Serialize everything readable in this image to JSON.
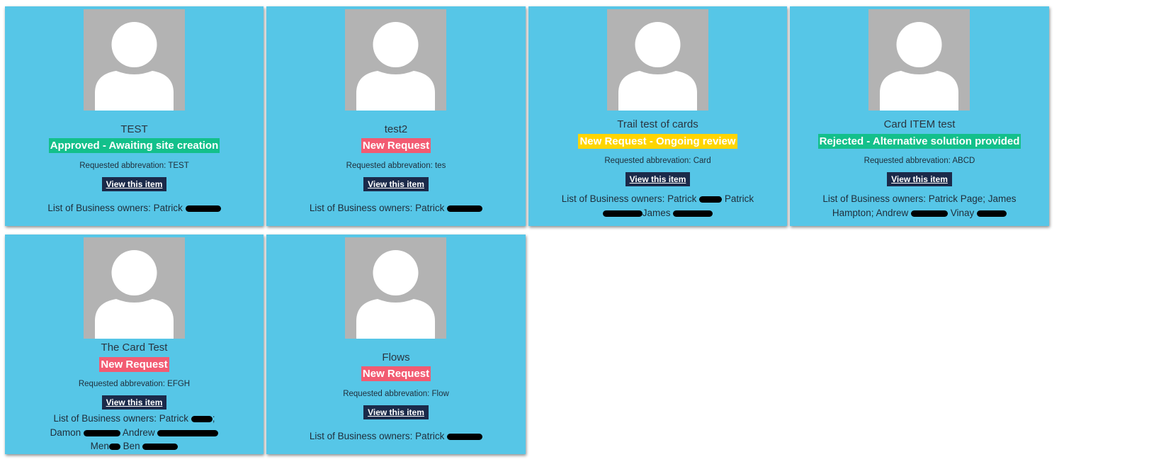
{
  "button_label": "View this item",
  "abbr_prefix": "Requested abbrevation: ",
  "owners_prefix": "List of Business owners: ",
  "colors": {
    "card_bg": "#56c6e7",
    "status_green": "#13c08b",
    "status_red": "#f25b72",
    "status_yellow": "#ffd500",
    "button_bg": "#1b2a4a",
    "avatar_bg": "#b3b3b3"
  },
  "icons": {
    "avatar": "person-placeholder-icon"
  },
  "cards": [
    {
      "title": "TEST",
      "status": "Approved - Awaiting site creation",
      "status_color": "green",
      "abbreviation": "TEST",
      "owners_lines": [
        "Patrick"
      ]
    },
    {
      "title": "test2",
      "status": "New Request",
      "status_color": "red",
      "abbreviation": "tes",
      "owners_lines": [
        "Patrick"
      ]
    },
    {
      "title": "Trail test of cards",
      "status": "New Request - Ongoing review",
      "status_color": "yellow",
      "abbreviation": "Card",
      "owners_lines": [
        "Patrick",
        "Patrick",
        "James"
      ]
    },
    {
      "title": "Card ITEM test",
      "status": "Rejected - Alternative solution provided",
      "status_color": "green",
      "abbreviation": "ABCD",
      "owners_lines": [
        "Patrick Page; James",
        "Hampton; Andrew",
        "Vinay"
      ]
    },
    {
      "title": "The Card Test",
      "status": "New Request",
      "status_color": "red",
      "abbreviation": "EFGH",
      "owners_lines": [
        "Patrick",
        "Damon",
        "Andrew",
        "Men",
        "Ben"
      ]
    },
    {
      "title": "Flows",
      "status": "New Request",
      "status_color": "red",
      "abbreviation": "Flow",
      "owners_lines": [
        "Patrick"
      ]
    }
  ]
}
